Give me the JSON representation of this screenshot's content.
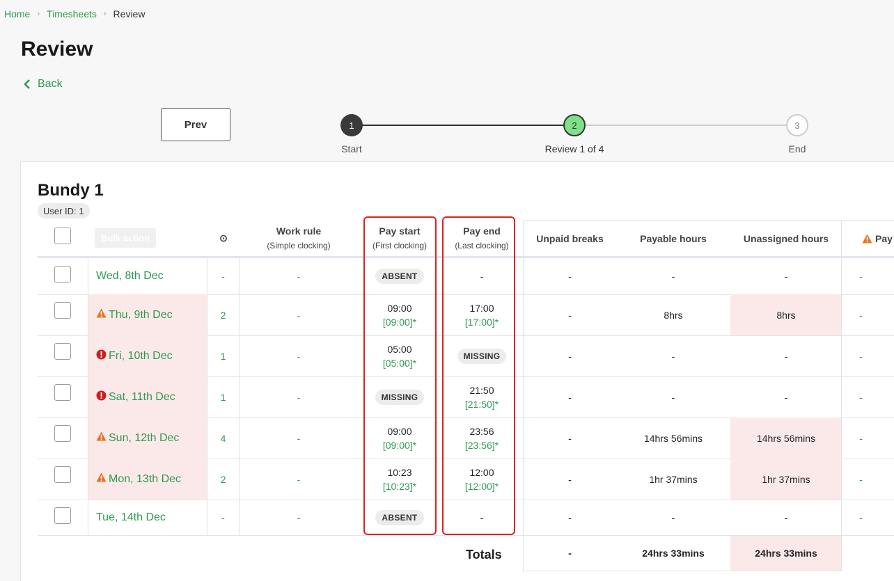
{
  "breadcrumb": {
    "home": "Home",
    "timesheets": "Timesheets",
    "current": "Review"
  },
  "page_title": "Review",
  "back_label": "Back",
  "prev_label": "Prev",
  "stepper": [
    {
      "num": "1",
      "label": "Start"
    },
    {
      "num": "2",
      "label": "Review 1 of 4"
    },
    {
      "num": "3",
      "label": "End"
    }
  ],
  "bundy": {
    "title": "Bundy 1",
    "user_id": "User ID: 1"
  },
  "bulk_action": "Bulk action",
  "headers": {
    "clock": "⊙",
    "work_rule": "Work rule",
    "work_rule_sub": "(Simple clocking)",
    "pay_start": "Pay start",
    "pay_start_sub": "(First clocking)",
    "pay_end": "Pay end",
    "pay_end_sub": "(Last clocking)",
    "unpaid_breaks": "Unpaid breaks",
    "payable_hours": "Payable hours",
    "unassigned_hours": "Unassigned hours",
    "pay": "Pay"
  },
  "rows": [
    {
      "date": "Wed, 8th Dec",
      "icon": "none",
      "count": "-",
      "work_rule": "-",
      "start_badge": "ABSENT",
      "start": "",
      "start_sub": "",
      "end_badge": "",
      "end": "-",
      "end_sub": "",
      "breaks": "-",
      "payable": "-",
      "unassigned": "-",
      "pay": "-"
    },
    {
      "date": "Thu, 9th Dec",
      "icon": "warning-icon",
      "count": "2",
      "work_rule": "-",
      "start_badge": "",
      "start": "09:00",
      "start_sub": "[09:00]*",
      "end_badge": "",
      "end": "17:00",
      "end_sub": "[17:00]*",
      "breaks": "-",
      "payable": "8hrs",
      "unassigned": "8hrs",
      "pay": "-"
    },
    {
      "date": "Fri, 10th Dec",
      "icon": "error-icon",
      "count": "1",
      "work_rule": "-",
      "start_badge": "",
      "start": "05:00",
      "start_sub": "[05:00]*",
      "end_badge": "MISSING",
      "end": "",
      "end_sub": "",
      "breaks": "-",
      "payable": "-",
      "unassigned": "-",
      "pay": "-"
    },
    {
      "date": "Sat, 11th Dec",
      "icon": "error-icon",
      "count": "1",
      "work_rule": "-",
      "start_badge": "MISSING",
      "start": "",
      "start_sub": "",
      "end_badge": "",
      "end": "21:50",
      "end_sub": "[21:50]*",
      "breaks": "-",
      "payable": "-",
      "unassigned": "-",
      "pay": "-"
    },
    {
      "date": "Sun, 12th Dec",
      "icon": "warning-icon",
      "count": "4",
      "work_rule": "-",
      "start_badge": "",
      "start": "09:00",
      "start_sub": "[09:00]*",
      "end_badge": "",
      "end": "23:56",
      "end_sub": "[23:56]*",
      "breaks": "-",
      "payable": "14hrs 56mins",
      "unassigned": "14hrs 56mins",
      "pay": "-"
    },
    {
      "date": "Mon, 13th Dec",
      "icon": "warning-icon",
      "count": "2",
      "work_rule": "-",
      "start_badge": "",
      "start": "10:23",
      "start_sub": "[10:23]*",
      "end_badge": "",
      "end": "12:00",
      "end_sub": "[12:00]*",
      "breaks": "-",
      "payable": "1hr 37mins",
      "unassigned": "1hr 37mins",
      "pay": "-"
    },
    {
      "date": "Tue, 14th Dec",
      "icon": "none",
      "count": "-",
      "work_rule": "-",
      "start_badge": "ABSENT",
      "start": "",
      "start_sub": "",
      "end_badge": "",
      "end": "-",
      "end_sub": "",
      "breaks": "-",
      "payable": "-",
      "unassigned": "-",
      "pay": "-"
    }
  ],
  "totals": {
    "label": "Totals",
    "breaks": "-",
    "payable": "24hrs 33mins",
    "unassigned": "24hrs 33mins"
  },
  "colors": {
    "accent": "#2e9a4f",
    "warning": "#e8711c",
    "error": "#cc1f1f",
    "highlight": "#fbe9e9",
    "annotation": "#e02020"
  }
}
